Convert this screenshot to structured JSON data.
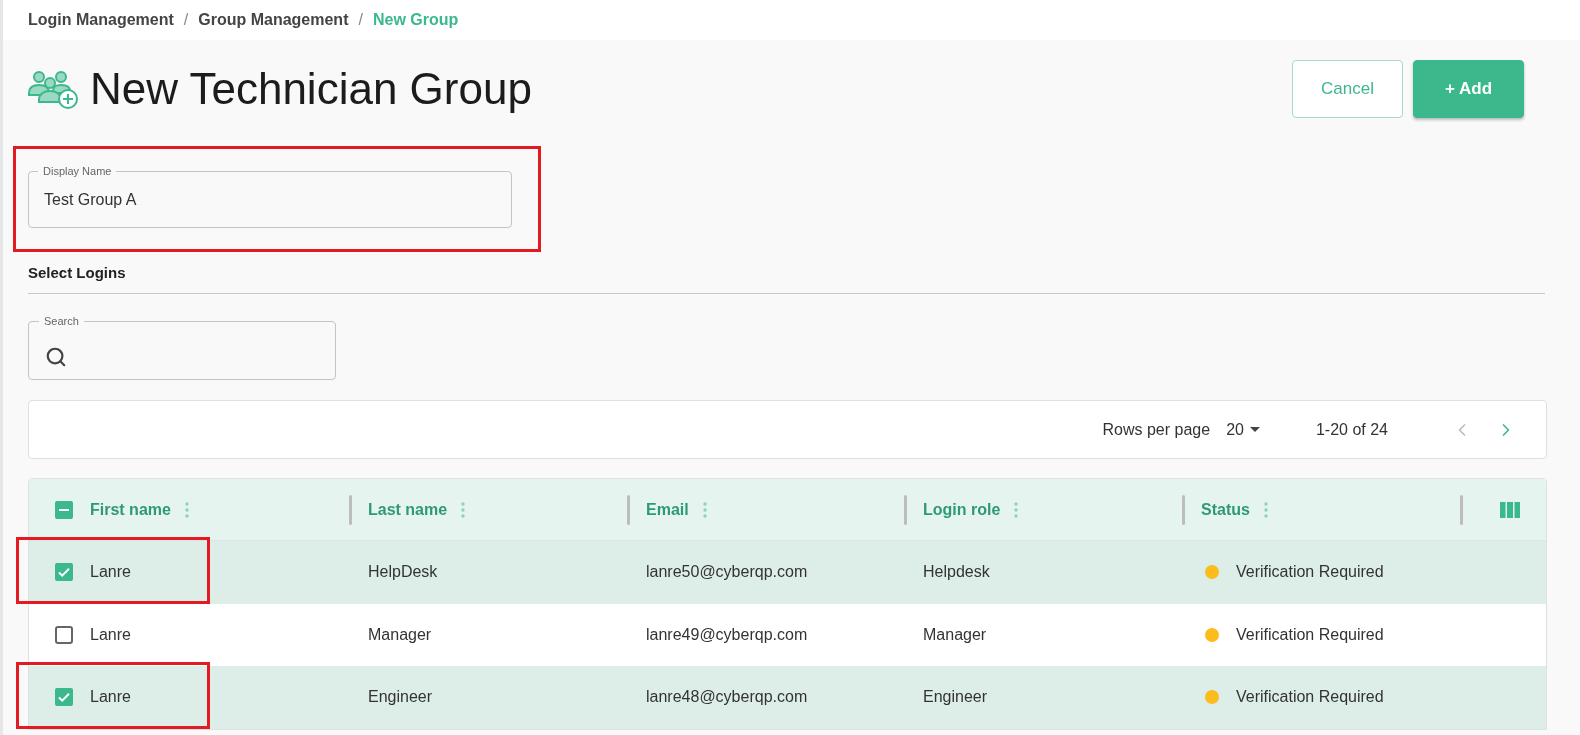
{
  "breadcrumb": [
    {
      "label": "Login Management",
      "current": false,
      "separator": "/"
    },
    {
      "label": "Group Management",
      "current": false,
      "separator": "/"
    },
    {
      "label": "New Group",
      "current": true
    }
  ],
  "title": "New Technician Group",
  "buttons": [
    {
      "label": "Cancel",
      "kind": "outlined"
    },
    {
      "label": "+ Add",
      "kind": "filled"
    }
  ],
  "display_name": {
    "label": "Display Name",
    "value": "Test Group A",
    "highlighted": true
  },
  "section_title": "Select Logins",
  "search": {
    "label": "Search"
  },
  "pagination": {
    "rows_per_page_label": "Rows per page",
    "rows_per_page": "20",
    "range": "1-20 of 24",
    "prev_disabled": true,
    "next_disabled": false
  },
  "table": {
    "select_all": {
      "indeterminate": true
    },
    "columns": [
      "First name",
      "Last name",
      "Email",
      "Login role",
      "Status"
    ],
    "rows": [
      {
        "selected": true,
        "highlighted": true,
        "first_name": "Lanre",
        "last_name": "HelpDesk",
        "email": "lanre50@cyberqp.com",
        "login_role": "Helpdesk",
        "status": "Verification Required",
        "color": "#fbbc1c"
      },
      {
        "selected": false,
        "highlighted": false,
        "first_name": "Lanre",
        "last_name": "Manager",
        "email": "lanre49@cyberqp.com",
        "login_role": "Manager",
        "status": "Verification Required",
        "color": "#fbbc1c"
      },
      {
        "selected": true,
        "highlighted": true,
        "first_name": "Lanre",
        "last_name": "Engineer",
        "email": "lanre48@cyberqp.com",
        "login_role": "Engineer",
        "status": "Verification Required",
        "color": "#fbbc1c"
      }
    ]
  }
}
